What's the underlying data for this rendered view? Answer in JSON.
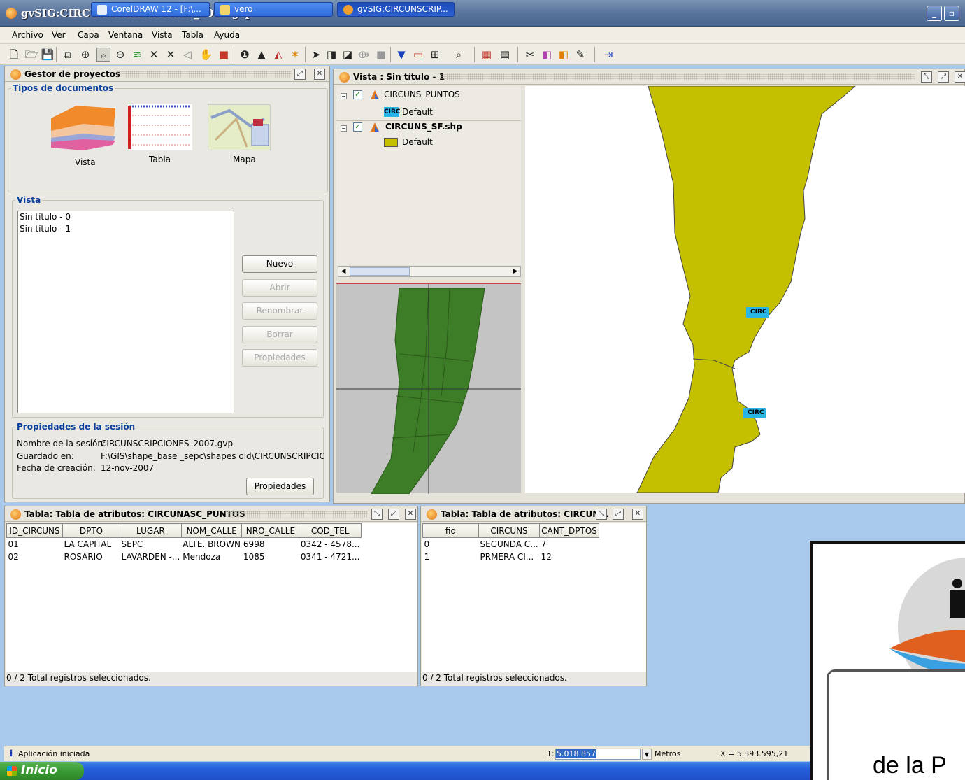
{
  "window": {
    "title": "gvSIG:CIRCUNSCRIPCIONES_2007.gvp"
  },
  "menu": [
    "Archivo",
    "Ver",
    "Capa",
    "Ventana",
    "Vista",
    "Tabla",
    "Ayuda"
  ],
  "project_manager": {
    "title": "Gestor de proyectos",
    "doc_types_legend": "Tipos de documentos",
    "doc_types": [
      "Vista",
      "Tabla",
      "Mapa"
    ],
    "vista_legend": "Vista",
    "views": [
      "Sin título - 0",
      "Sin título - 1"
    ],
    "buttons": {
      "new": "Nuevo",
      "open": "Abrir",
      "rename": "Renombrar",
      "delete": "Borrar",
      "properties": "Propiedades"
    },
    "session": {
      "legend": "Propiedades de la sesión",
      "name_label": "Nombre de la sesión:",
      "name_value": "CIRCUNSCRIPCIONES_2007.gvp",
      "saved_label": "Guardado en:",
      "saved_value": "F:\\GIS\\shape_base _sepc\\shapes old\\CIRCUNSCRIPCIO...",
      "date_label": "Fecha de creación:",
      "date_value": "12-nov-2007",
      "properties_button": "Propiedades"
    }
  },
  "view_window": {
    "title": "Vista : Sin título - 1",
    "layers": [
      {
        "name": "CIRCUNS_PUNTOS",
        "legend": "Default",
        "symbol_text": "CIRC",
        "bold": false
      },
      {
        "name": "CIRCUNS_SF.shp",
        "legend": "Default",
        "bold": true
      }
    ],
    "map_labels": [
      "CIRC",
      "CIRC"
    ],
    "colors": {
      "polygon": "#c4c000",
      "overview": "#3e7d27"
    }
  },
  "table1": {
    "title": "Tabla: Tabla de atributos: CIRCUNASC_PUNTOS",
    "columns": [
      "ID_CIRCUNS",
      "DPTO",
      "LUGAR",
      "NOM_CALLE",
      "NRO_CALLE",
      "COD_TEL"
    ],
    "rows": [
      [
        "01",
        "LA CAPITAL",
        "SEPC",
        "ALTE. BROWN",
        "6998",
        "0342 - 4578..."
      ],
      [
        "02",
        "ROSARIO",
        "LAVARDEN -...",
        "Mendoza",
        "1085",
        "0341 - 4721..."
      ]
    ],
    "status": "0 / 2 Total registros seleccionados."
  },
  "table2": {
    "title": "Tabla: Tabla de atributos: CIRCUN...",
    "columns": [
      "fid",
      "CIRCUNS",
      "CANT_DPTOS"
    ],
    "rows": [
      [
        "0",
        "SEGUNDA C...",
        "7"
      ],
      [
        "1",
        "PRMERA CI...",
        "12"
      ]
    ],
    "status": "0 / 2 Total registros seleccionados."
  },
  "statusbar": {
    "message": "Aplicación iniciada",
    "scale_prefix": "1:",
    "scale_value": "5.018.857",
    "units": "Metros",
    "coord": "X = 5.393.595,21"
  },
  "taskbar": {
    "start": "Inicio",
    "tasks": [
      "CorelDRAW 12 - [F:\\...",
      "vero",
      "gvSIG:CIRCUNSCRIP..."
    ]
  },
  "overlay": {
    "text": "de la P"
  }
}
